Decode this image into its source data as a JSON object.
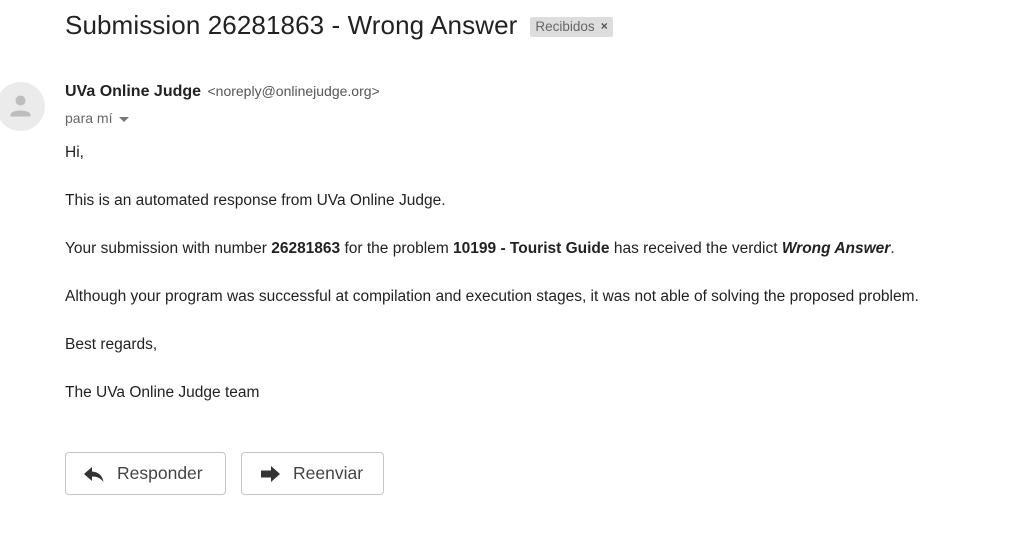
{
  "email": {
    "subject": "Submission 26281863 - Wrong Answer",
    "label": "Recibidos",
    "label_close": "×",
    "sender_name": "UVa Online Judge",
    "sender_email": "<noreply@onlinejudge.org>",
    "recipient": "para mí",
    "body": {
      "greeting": "Hi,",
      "line1": "This is an automated response from UVa Online Judge.",
      "line2_a": "Your submission with number ",
      "submission_number": "26281863",
      "line2_b": " for the problem ",
      "problem": "10199 - Tourist Guide",
      "line2_c": " has received the verdict ",
      "verdict": "Wrong Answer",
      "line2_d": ".",
      "line3": "Although your program was successful at compilation and execution stages, it was not able of solving the proposed problem.",
      "closing": "Best regards,",
      "signature": "The UVa Online Judge team"
    }
  },
  "actions": {
    "reply_label": "Responder",
    "forward_label": "Reenviar"
  },
  "icons": {
    "avatar": "person-icon",
    "reply": "reply-arrow-icon",
    "forward": "forward-arrow-icon",
    "dropdown": "caret-down-icon"
  },
  "colors": {
    "chip_background": "#dddddd",
    "avatar_background": "#ebebeb",
    "button_border": "#c4c4c4"
  }
}
